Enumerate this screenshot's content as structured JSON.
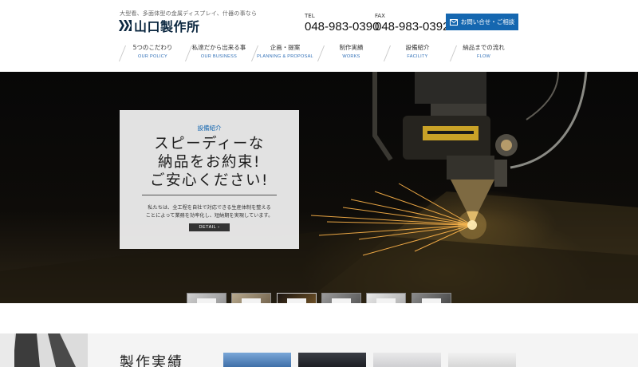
{
  "header": {
    "tagline": "大型看、多面体型の金属ディスプレイ、什器の事なら",
    "logo_text": "山口製作所",
    "tel_label": "TEL",
    "tel_number": "048-983-0390",
    "fax_label": "FAX",
    "fax_number": "048-983-0392",
    "contact_button": "お問い合せ・ご相談"
  },
  "nav": [
    {
      "jp": "5つのこだわり",
      "en": "OUR POLICY"
    },
    {
      "jp": "私達だから出来る事",
      "en": "OUR BUSINESS"
    },
    {
      "jp": "企画・提案",
      "en": "PLANNING & PROPOSAL"
    },
    {
      "jp": "制作実績",
      "en": "WORKS"
    },
    {
      "jp": "設備紹介",
      "en": "FACILITY"
    },
    {
      "jp": "納品までの流れ",
      "en": "FLOW"
    }
  ],
  "hero": {
    "label": "設備紹介",
    "headline": [
      "スピーディーな",
      "納品をお約束!",
      "ご安心ください!"
    ],
    "body": [
      "私たちは、全工程を自社で対応できる生産体制を整える",
      "ことによって業務を効率化し、短納期を実現しています。"
    ],
    "button": "DETAIL ›"
  },
  "thumbnails": [
    "slide-1",
    "slide-2",
    "slide-3",
    "slide-4",
    "slide-5",
    "slide-6"
  ],
  "works": {
    "title": "製作実績"
  },
  "colors": {
    "brand_blue": "#1567b0",
    "logo_navy": "#0b2740"
  }
}
